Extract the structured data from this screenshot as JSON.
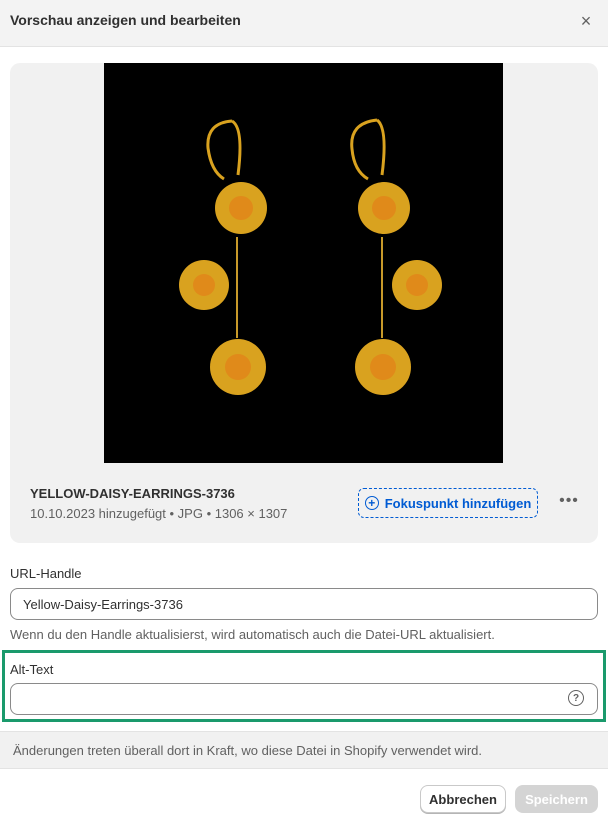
{
  "header": {
    "title": "Vorschau anzeigen und bearbeiten",
    "close_icon": "×"
  },
  "preview": {
    "image_icon": "yellow-daisy-earrings-image",
    "file_name": "YELLOW-DAISY-EARRINGS-3736",
    "file_meta": "10.10.2023 hinzugefügt • JPG • 1306 × 1307",
    "focus_button_label": "Fokuspunkt hinzufügen",
    "focus_button_icon": "+",
    "more_icon": "•••"
  },
  "url_handle": {
    "label": "URL-Handle",
    "value": "Yellow-Daisy-Earrings-3736",
    "help": "Wenn du den Handle aktualisierst, wird automatisch auch die Datei-URL aktualisiert."
  },
  "alt_text": {
    "label": "Alt-Text",
    "value": "",
    "help_icon": "?"
  },
  "info": {
    "text": "Änderungen treten überall dort in Kraft, wo diese Datei in Shopify verwendet wird."
  },
  "footer": {
    "cancel_label": "Abbrechen",
    "save_label": "Speichern"
  },
  "colors": {
    "accent": "#005bd3",
    "highlight": "#1a9a6c",
    "image_background": "#000000",
    "gold": "#d9a21f"
  }
}
